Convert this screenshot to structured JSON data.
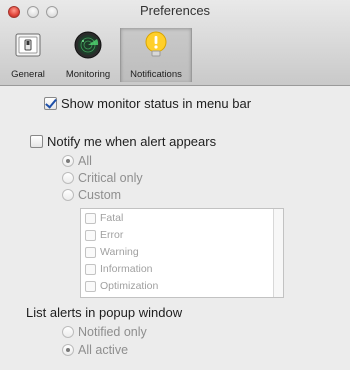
{
  "window": {
    "title": "Preferences"
  },
  "toolbar": {
    "items": [
      {
        "label": "General",
        "icon": "general-switch-icon",
        "selected": false
      },
      {
        "label": "Monitoring",
        "icon": "radar-icon",
        "selected": false
      },
      {
        "label": "Notifications",
        "icon": "alert-bulb-icon",
        "selected": true
      }
    ]
  },
  "settings": {
    "show_status": {
      "label": "Show monitor status in menu bar",
      "checked": true
    },
    "notify": {
      "label": "Notify me when alert appears",
      "checked": false
    },
    "notify_options": [
      {
        "label": "All",
        "selected": true
      },
      {
        "label": "Critical only",
        "selected": false
      },
      {
        "label": "Custom",
        "selected": false
      }
    ],
    "custom_levels": [
      {
        "label": "Fatal",
        "checked": false
      },
      {
        "label": "Error",
        "checked": false
      },
      {
        "label": "Warning",
        "checked": false
      },
      {
        "label": "Information",
        "checked": false
      },
      {
        "label": "Optimization",
        "checked": false
      }
    ],
    "popup": {
      "heading": "List alerts in popup window",
      "options": [
        {
          "label": "Notified only",
          "selected": false
        },
        {
          "label": "All active",
          "selected": true
        }
      ]
    }
  },
  "colors": {
    "close_button": "#e0443a",
    "checkmark": "#1d4fa8",
    "toolbar_selected": "#bdbdbd"
  }
}
